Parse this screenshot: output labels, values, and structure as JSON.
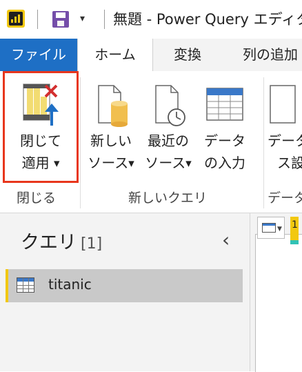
{
  "window": {
    "title": "無題 - Power Query エディタ",
    "qa_dropdown": "▾"
  },
  "tabs": [
    {
      "label": "ファイル"
    },
    {
      "label": "ホーム"
    },
    {
      "label": "変換"
    },
    {
      "label": "列の追加"
    }
  ],
  "ribbon": {
    "close_apply": {
      "line1": "閉じて",
      "line2": "適用",
      "caret": "▼"
    },
    "new_source": {
      "line1": "新しい",
      "line2": "ソース",
      "caret": "▼"
    },
    "recent_sources": {
      "line1": "最近の",
      "line2": "ソース",
      "caret": "▼"
    },
    "enter_data": {
      "line1": "データ",
      "line2": "の入力"
    },
    "data_source_settings": {
      "line1": "データ",
      "line2": "ス設"
    },
    "groups": {
      "close": "閉じる",
      "new_query": "新しいクエリ",
      "data_sources": "データ"
    }
  },
  "queries": {
    "title": "クエリ",
    "count": "[1]",
    "collapse_glyph": "‹",
    "items": [
      {
        "name": "titanic"
      }
    ]
  },
  "grid": {
    "first_col_partial": "1"
  },
  "colors": {
    "accent_blue": "#1e6fc5",
    "highlight_red": "#e8361c",
    "pbi_yellow": "#f2c811",
    "selection_gray": "#c9c9c9"
  }
}
